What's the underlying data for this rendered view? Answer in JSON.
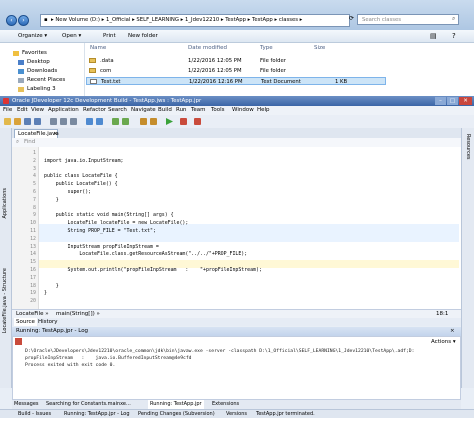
{
  "explorer": {
    "breadcrumb": "▸ New Volume (D:) ▸ 1_Official ▸ SELF_LEARNING ▸ 1_Jdev12210 ▸ TestApp ▸ TestApp ▸ classes ▸",
    "search_placeholder": "Search classes",
    "toolbar": {
      "organize": "Organize ▾",
      "open": "Open ▾",
      "print": "Print",
      "new_folder": "New folder"
    },
    "favorites": {
      "header": "Favorites",
      "items": [
        "Desktop",
        "Downloads",
        "Recent Places",
        "Labeling 3"
      ]
    },
    "columns": {
      "name": "Name",
      "date": "Date modified",
      "type": "Type",
      "size": "Size"
    },
    "files": [
      {
        "name": ".data",
        "date": "1/22/2016 12:05 PM",
        "type": "File folder",
        "size": ""
      },
      {
        "name": "com",
        "date": "1/22/2016 12:05 PM",
        "type": "File folder",
        "size": ""
      },
      {
        "name": "Test.txt",
        "date": "1/22/2016 12:16 PM",
        "type": "Text Document",
        "size": "1 KB"
      }
    ]
  },
  "jdev": {
    "title": "Oracle JDeveloper 12c Development Build - TestApp.jws : TestApp.jpr",
    "menu": [
      "File",
      "Edit",
      "View",
      "Application",
      "Refactor",
      "Search",
      "Navigate",
      "Build",
      "Run",
      "Team",
      "Tools",
      "Window",
      "Help"
    ],
    "left_tabs": [
      "LocateFile.java - Structure",
      "Applications"
    ],
    "right_tabs": [
      "Resources"
    ],
    "editor_tab": "LocateFile.java",
    "find_placeholder": "Find",
    "lines": [
      {
        "n": "1",
        "t": ""
      },
      {
        "n": "2",
        "t": "import java.io.InputStream;"
      },
      {
        "n": "3",
        "t": ""
      },
      {
        "n": "4",
        "t": "public class LocateFile {"
      },
      {
        "n": "5",
        "t": "    public LocateFile() {"
      },
      {
        "n": "6",
        "t": "        super();"
      },
      {
        "n": "7",
        "t": "    }"
      },
      {
        "n": "8",
        "t": ""
      },
      {
        "n": "9",
        "t": "    public static void main(String[] args) {"
      },
      {
        "n": "10",
        "t": "        LocateFile locateFile = new LocateFile();"
      },
      {
        "n": "11",
        "t": "        String PROP_FILE = \"Test.txt\";"
      },
      {
        "n": "12",
        "t": ""
      },
      {
        "n": "13",
        "t": "        InputStream propFileInpStream ="
      },
      {
        "n": "14",
        "t": "            LocateFile.class.getResourceAsStream(\"../../\"+PROP_FILE);"
      },
      {
        "n": "15",
        "t": ""
      },
      {
        "n": "16",
        "t": "        System.out.println(\"propFileInpStream   :    \"+propFileInpStream);"
      },
      {
        "n": "17",
        "t": ""
      },
      {
        "n": "18",
        "t": "    }"
      },
      {
        "n": "19",
        "t": "}"
      },
      {
        "n": "20",
        "t": ""
      }
    ],
    "breadcrumb": {
      "a": "LocateFile »",
      "b": "main(String[]) »"
    },
    "cursor_pos": "18:1",
    "source_tabs": {
      "source": "Source",
      "history": "History"
    },
    "log_title": "Running: TestApp.jpr - Log",
    "actions": "Actions ▾",
    "log_lines": [
      "D:\\Oracle\\JDevelopers\\Jdev12210\\oracle_common\\jdk\\bin\\javaw.exe -server -classpath D:\\1_Official\\SELF_LEARNING\\1_Jdev12210\\TestApp\\.adf;D:",
      "propFileInpStream   :    java.io.BufferedInputStream@4e9cfd",
      "Process exited with exit code 0."
    ],
    "bottom_tabs": [
      "Messages",
      "Searching for Constants.mainxe...",
      "Running: TestApp.jpr",
      "Extensions"
    ],
    "status_items": [
      "Build - Issues",
      "Running: TestApp.jpr - Log",
      "Pending Changes (Subversion)",
      "Versions"
    ],
    "status_message": "TestApp.jpr terminated."
  }
}
